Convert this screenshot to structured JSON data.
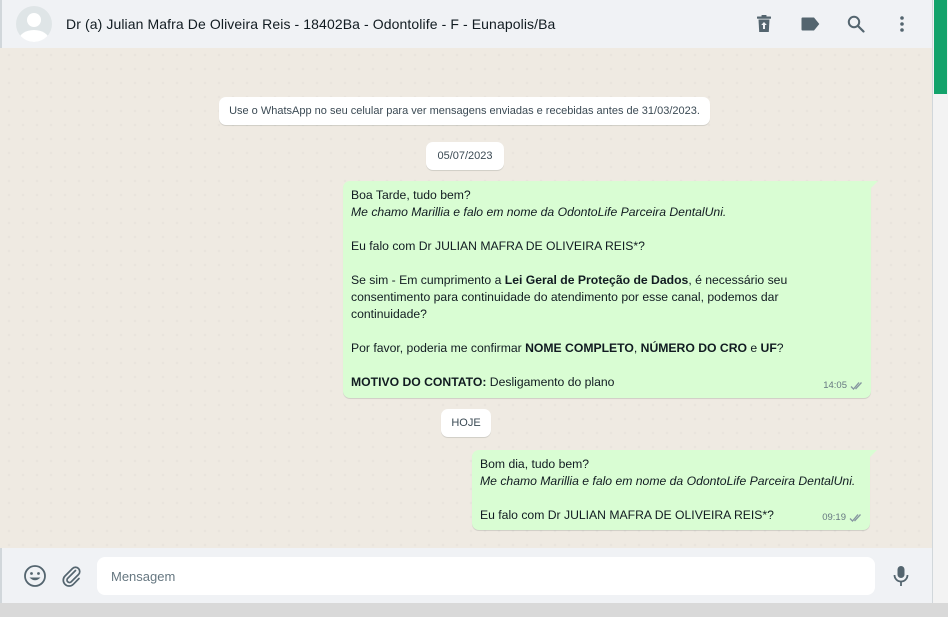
{
  "header": {
    "title": "Dr (a) Julian Mafra De Oliveira Reis - 18402Ba - Odontolife - F - Eunapolis/Ba",
    "icons": [
      "archive-icon",
      "label-icon",
      "search-icon",
      "menu-icon"
    ]
  },
  "chat": {
    "notice": "Use o WhatsApp no seu celular para ver mensagens enviadas e recebidas antes de 31/03/2023.",
    "date1": "05/07/2023",
    "date2": "HOJE",
    "message1": {
      "l1": "Boa Tarde, tudo bem?",
      "l2": "Me chamo Marillia e falo em nome da OdontoLife Parceira DentalUni.",
      "l3": "Eu falo com Dr JULIAN MAFRA DE OLIVEIRA REIS*?",
      "l4a": "Se sim - Em cumprimento a ",
      "l4b": "Lei Geral de Proteção de Dados",
      "l4c": ", é necessário seu",
      "l5": "consentimento para continuidade do atendimento por esse canal, podemos dar",
      "l6": "continuidade?",
      "l7a": "Por favor, poderia me confirmar ",
      "l7b": "NOME COMPLETO",
      "l7c": ", ",
      "l7d": "NÚMERO DO CRO",
      "l7e": " e ",
      "l7f": "UF",
      "l7g": "?",
      "l8a": "MOTIVO DO CONTATO:",
      "l8b": " Desligamento do plano",
      "time": "14:05"
    },
    "message2": {
      "l1": "Bom dia, tudo bem?",
      "l2": "Me chamo Marillia e falo em nome da OdontoLife Parceira DentalUni.",
      "l3": "Eu falo com Dr JULIAN MAFRA DE OLIVEIRA REIS*?",
      "time": "09:19"
    }
  },
  "composer": {
    "placeholder": "Mensagem"
  },
  "colors": {
    "outgoing_bubble": "#d9fdd3",
    "chat_bg": "#efeae2",
    "bar_bg": "#f0f2f5",
    "read_ticks": "#8696a0",
    "scroll_thumb": "#13a36b"
  }
}
